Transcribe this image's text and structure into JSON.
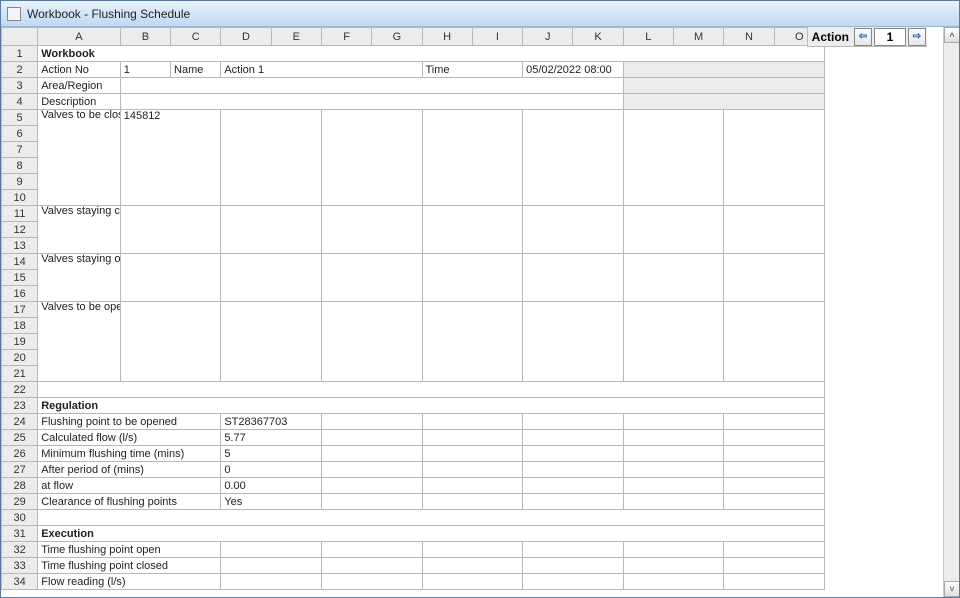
{
  "window": {
    "title": "Workbook - Flushing Schedule"
  },
  "toolbar": {
    "label": "Action",
    "prev": "⇦",
    "next": "⇨",
    "value": "1"
  },
  "columns": [
    "A",
    "B",
    "C",
    "D",
    "E",
    "F",
    "G",
    "H",
    "I",
    "J",
    "K",
    "L",
    "M",
    "N",
    "O"
  ],
  "rows": {
    "r1_A": "Workbook",
    "r2_A": "Action No",
    "r2_B": "1",
    "r2_C": "Name",
    "r2_D": "Action 1",
    "r2_H": "Time",
    "r2_J": "05/02/2022 08:00",
    "r3_A": "Area/Region",
    "r4_A": "Description",
    "r5_A": "Valves to be closed",
    "r5_B": "145812",
    "r11_A": "Valves staying closed from the prev. action",
    "r14_A": "Valves staying open from the prev. action",
    "r17_A": "Valves to be opened",
    "r23_A": "Regulation",
    "r24_A": "Flushing point to be opened",
    "r24_D": "ST28367703",
    "r25_A": "Calculated flow (l/s)",
    "r25_D": "5.77",
    "r26_A": "Minimum flushing time (mins)",
    "r26_D": "5",
    "r27_A": "After period of (mins)",
    "r27_D": "0",
    "r28_A": "at flow",
    "r28_D": "0.00",
    "r29_A": "Clearance of flushing points",
    "r29_D": "Yes",
    "r31_A": "Execution",
    "r32_A": "Time flushing point open",
    "r33_A": "Time flushing point closed",
    "r34_A": "Flow reading (l/s)"
  }
}
